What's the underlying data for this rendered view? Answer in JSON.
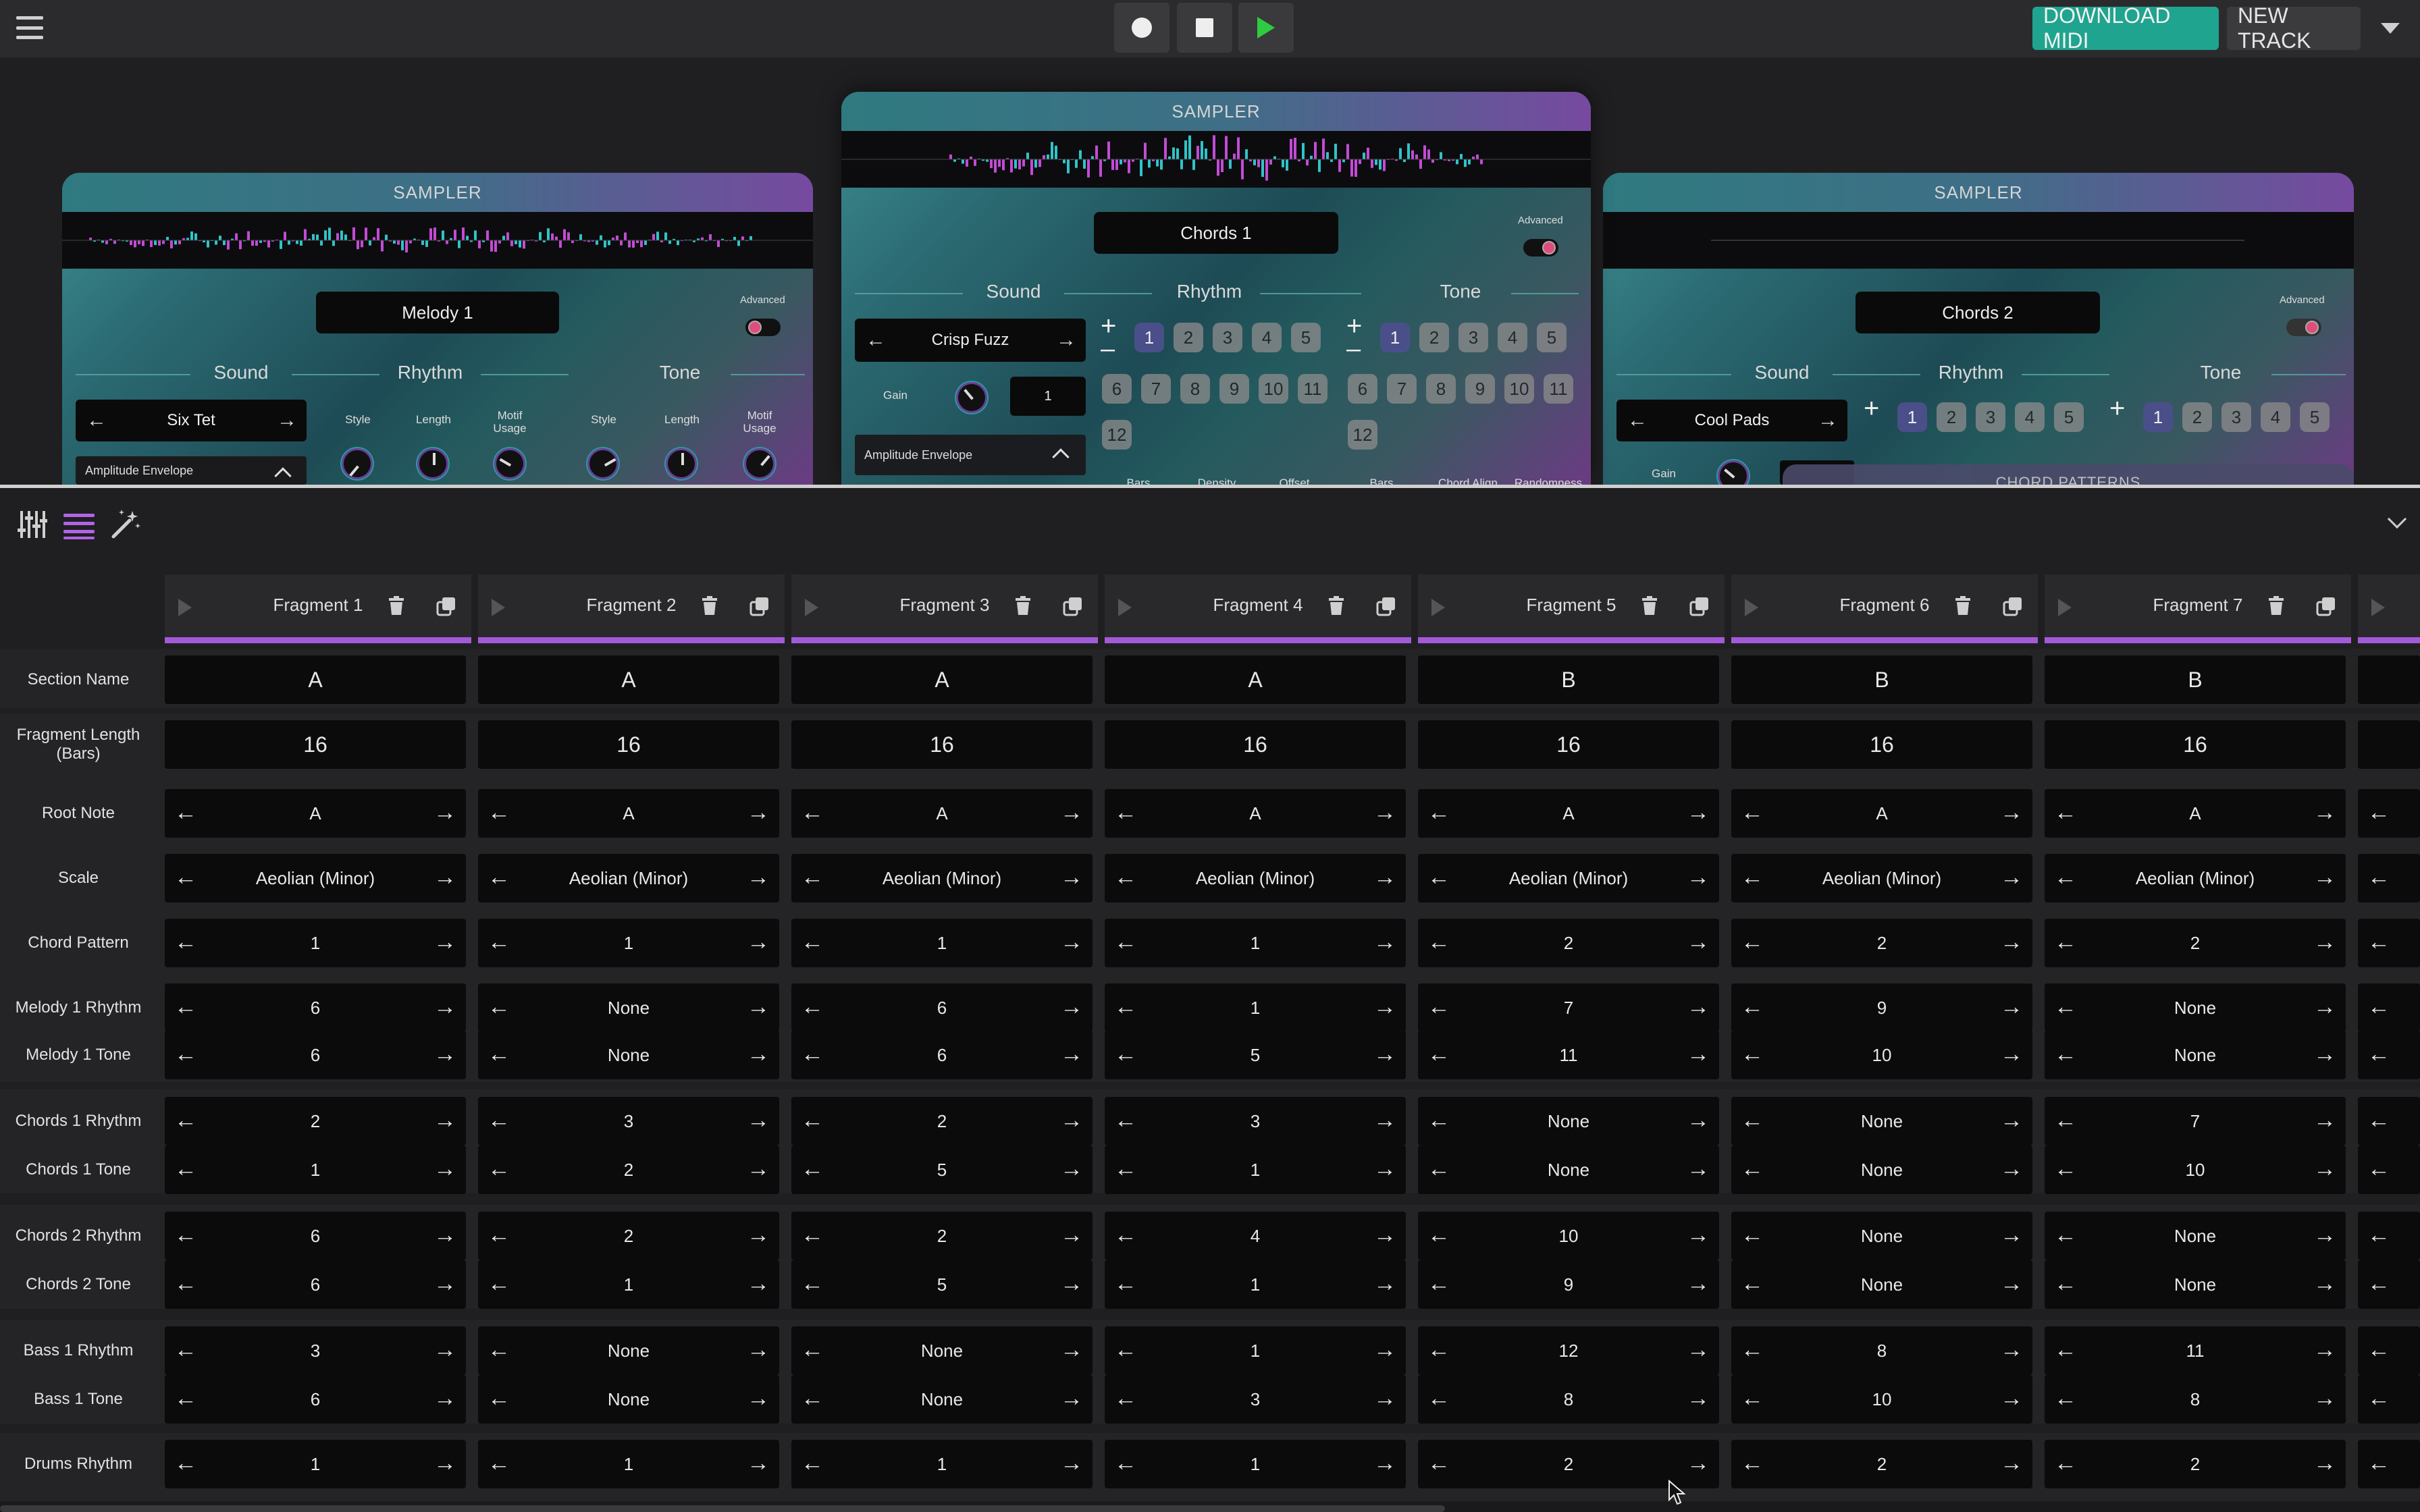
{
  "toolbar": {
    "download_label": "DOWNLOAD MIDI",
    "new_track_label": "NEW TRACK",
    "accent": "#1fa48f"
  },
  "samplers": [
    {
      "header": "SAMPLER",
      "name": "Melody 1",
      "advanced": "Advanced",
      "sections": [
        "Sound",
        "Rhythm",
        "Tone"
      ],
      "sound_value": "Six Tet",
      "knob_labels": [
        "Style",
        "Length",
        "Motif Usage",
        "Style",
        "Length",
        "Motif Usage"
      ],
      "amp_env": "Amplitude Envelope"
    },
    {
      "header": "SAMPLER",
      "name": "Chords 1",
      "advanced": "Advanced",
      "sections": [
        "Sound",
        "Rhythm",
        "Tone"
      ],
      "sound_value": "Crisp Fuzz",
      "gain_label": "Gain",
      "gain_value": "1",
      "amp_env": "Amplitude Envelope",
      "rhythm_nums": [
        "1",
        "2",
        "3",
        "4",
        "5",
        "6",
        "7",
        "8",
        "9",
        "10",
        "11",
        "12"
      ],
      "tone_nums": [
        "1",
        "2",
        "3",
        "4",
        "5",
        "6",
        "7",
        "8",
        "9",
        "10",
        "11",
        "12"
      ],
      "sub_labels": [
        "Bars",
        "Density",
        "Offset",
        "Bars",
        "Chord Align",
        "Randomness"
      ]
    },
    {
      "header": "SAMPLER",
      "name": "Chords 2",
      "advanced": "Advanced",
      "sections": [
        "Sound",
        "Rhythm",
        "Tone"
      ],
      "sound_value": "Cool Pads",
      "gain_label": "Gain",
      "rhythm_nums": [
        "1",
        "2",
        "3",
        "4",
        "5"
      ],
      "tone_nums": [
        "1",
        "2",
        "3",
        "4",
        "5"
      ],
      "chord_patterns": "CHORD PATTERNS"
    }
  ],
  "fragments": [
    "Fragment 1",
    "Fragment 2",
    "Fragment 3",
    "Fragment 4",
    "Fragment 5",
    "Fragment 6",
    "Fragment 7"
  ],
  "rows": [
    {
      "label": "Section Name",
      "values": [
        "A",
        "A",
        "A",
        "A",
        "B",
        "B",
        "B"
      ],
      "arrows": false
    },
    {
      "label": "Fragment Length (Bars)",
      "values": [
        "16",
        "16",
        "16",
        "16",
        "16",
        "16",
        "16"
      ],
      "arrows": false
    },
    {
      "label": "Root Note",
      "values": [
        "A",
        "A",
        "A",
        "A",
        "A",
        "A",
        "A"
      ],
      "arrows": true
    },
    {
      "label": "Scale",
      "values": [
        "Aeolian (Minor)",
        "Aeolian (Minor)",
        "Aeolian (Minor)",
        "Aeolian (Minor)",
        "Aeolian (Minor)",
        "Aeolian (Minor)",
        "Aeolian (Minor)"
      ],
      "arrows": true
    },
    {
      "label": "Chord Pattern",
      "values": [
        "1",
        "1",
        "1",
        "1",
        "2",
        "2",
        "2"
      ],
      "arrows": true
    },
    {
      "label": "Melody 1 Rhythm",
      "values": [
        "6",
        "None",
        "6",
        "1",
        "7",
        "9",
        "None"
      ],
      "arrows": true
    },
    {
      "label": "Melody 1 Tone",
      "values": [
        "6",
        "None",
        "6",
        "5",
        "11",
        "10",
        "None"
      ],
      "arrows": true
    },
    {
      "label": "Chords 1 Rhythm",
      "values": [
        "2",
        "3",
        "2",
        "3",
        "None",
        "None",
        "7"
      ],
      "arrows": true
    },
    {
      "label": "Chords 1 Tone",
      "values": [
        "1",
        "2",
        "5",
        "1",
        "None",
        "None",
        "10"
      ],
      "arrows": true
    },
    {
      "label": "Chords 2 Rhythm",
      "values": [
        "6",
        "2",
        "2",
        "4",
        "10",
        "None",
        "None"
      ],
      "arrows": true
    },
    {
      "label": "Chords 2 Tone",
      "values": [
        "6",
        "1",
        "5",
        "1",
        "9",
        "None",
        "None"
      ],
      "arrows": true
    },
    {
      "label": "Bass 1 Rhythm",
      "values": [
        "3",
        "None",
        "None",
        "1",
        "12",
        "8",
        "11"
      ],
      "arrows": true
    },
    {
      "label": "Bass 1 Tone",
      "values": [
        "6",
        "None",
        "None",
        "3",
        "8",
        "10",
        "8"
      ],
      "arrows": true
    },
    {
      "label": "Drums Rhythm",
      "values": [
        "1",
        "1",
        "1",
        "1",
        "2",
        "2",
        "2"
      ],
      "arrows": true
    }
  ]
}
